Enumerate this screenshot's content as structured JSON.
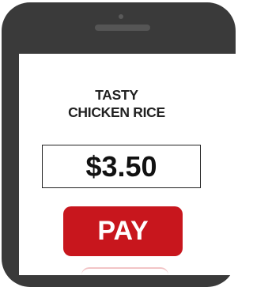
{
  "product": {
    "title_line1": "TASTY",
    "title_line2": "CHICKEN RICE"
  },
  "price": {
    "display": "$3.50"
  },
  "actions": {
    "pay_label": "PAY"
  },
  "colors": {
    "phone_body": "#3a3a3a",
    "pay_button": "#c8161d",
    "screen": "#ffffff"
  }
}
